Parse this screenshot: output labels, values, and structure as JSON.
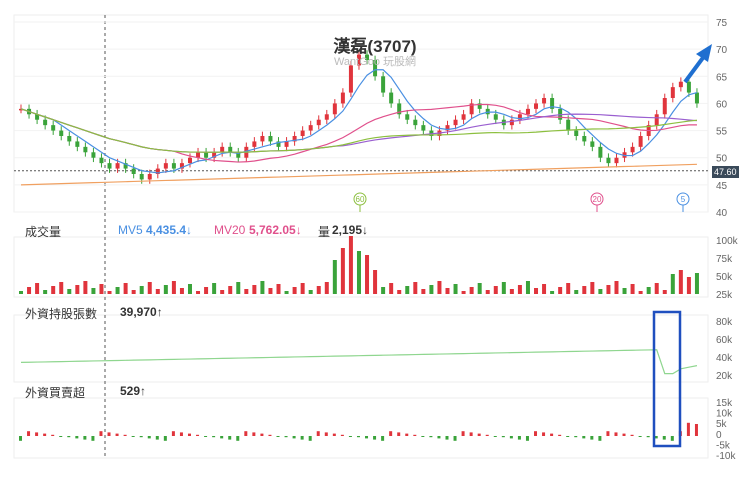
{
  "header": {
    "title": "漢磊(3707)",
    "watermark": "WantGoo 玩股網"
  },
  "price_panel": {
    "y_ticks": [
      "75",
      "70",
      "65",
      "60",
      "55",
      "50",
      "45",
      "40"
    ],
    "current_price": "47.60",
    "ma_badges": [
      "60",
      "20",
      "5"
    ]
  },
  "volume_panel": {
    "label": "成交量",
    "mv5_label": "MV5",
    "mv5_value": "4,435.4↓",
    "mv20_label": "MV20",
    "mv20_value": "5,762.05↓",
    "vol_label": "量",
    "vol_value": "2,195↓",
    "y_ticks": [
      "100k",
      "75k",
      "50k",
      "25k"
    ]
  },
  "foreign_hold_panel": {
    "label": "外資持股張數",
    "value": "39,970↑",
    "y_ticks": [
      "80k",
      "60k",
      "40k",
      "20k"
    ]
  },
  "foreign_net_panel": {
    "label": "外資買賣超",
    "value": "529↑",
    "y_ticks": [
      "15k",
      "10k",
      "5k",
      "0",
      "-5k",
      "-10k"
    ]
  },
  "colors": {
    "up": "#e0343c",
    "down": "#3aa33a",
    "ma5": "#4a90e2",
    "ma20": "#e0508c",
    "ma60": "#8cbf3f",
    "ma_purple": "#9a5fd0",
    "ma_orange": "#f0a060",
    "highlight": "#1f4fbf",
    "arrow": "#1f6fd0"
  },
  "chart_data": {
    "type": "candlestick",
    "title": "漢磊(3707)",
    "ylim": [
      40,
      75
    ],
    "closes": [
      59,
      58,
      57,
      56,
      55,
      54,
      53,
      52,
      51,
      50,
      49,
      48,
      49,
      48,
      47,
      46,
      47,
      48,
      49,
      48,
      49,
      50,
      51,
      50,
      51,
      52,
      51,
      50,
      52,
      53,
      54,
      53,
      52,
      53,
      54,
      55,
      56,
      57,
      58,
      60,
      62,
      67,
      69,
      68,
      65,
      62,
      60,
      58,
      57,
      56,
      55,
      54,
      55,
      56,
      57,
      58,
      60,
      59,
      58,
      57,
      56,
      57,
      58,
      59,
      60,
      61,
      59,
      57,
      55,
      54,
      53,
      52,
      50,
      49,
      50,
      51,
      52,
      54,
      56,
      58,
      61,
      63,
      64,
      62,
      60
    ],
    "current_price": 47.6
  }
}
